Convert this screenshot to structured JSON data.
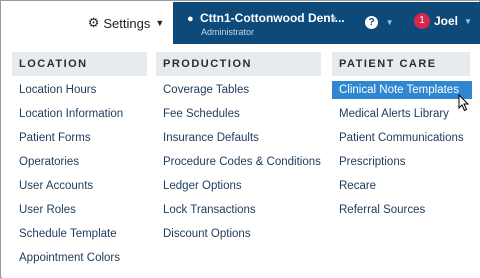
{
  "nav": {
    "settings_label": "Settings",
    "location_name": "Cttn1-Cottonwood Dent...",
    "location_role": "Administrator",
    "help_glyph": "?",
    "notification_count": "1",
    "user_name": "Joel"
  },
  "columns": [
    {
      "header": "LOCATION",
      "items": [
        "Location Hours",
        "Location Information",
        "Patient Forms",
        "Operatories",
        "User Accounts",
        "User Roles",
        "Schedule Template",
        "Appointment Colors"
      ]
    },
    {
      "header": "PRODUCTION",
      "items": [
        "Coverage Tables",
        "Fee Schedules",
        "Insurance Defaults",
        "Procedure Codes & Conditions",
        "Ledger Options",
        "Lock Transactions",
        "Discount Options"
      ]
    },
    {
      "header": "PATIENT CARE",
      "items": [
        "Clinical Note Templates",
        "Medical Alerts Library",
        "Patient Communications",
        "Prescriptions",
        "Recare",
        "Referral Sources"
      ]
    }
  ],
  "active_item": "Clinical Note Templates",
  "colors": {
    "nav_bg": "#0d4a7a",
    "header_bg": "#e7ebef",
    "active_bg": "#2f87d1",
    "badge": "#d6264c"
  }
}
